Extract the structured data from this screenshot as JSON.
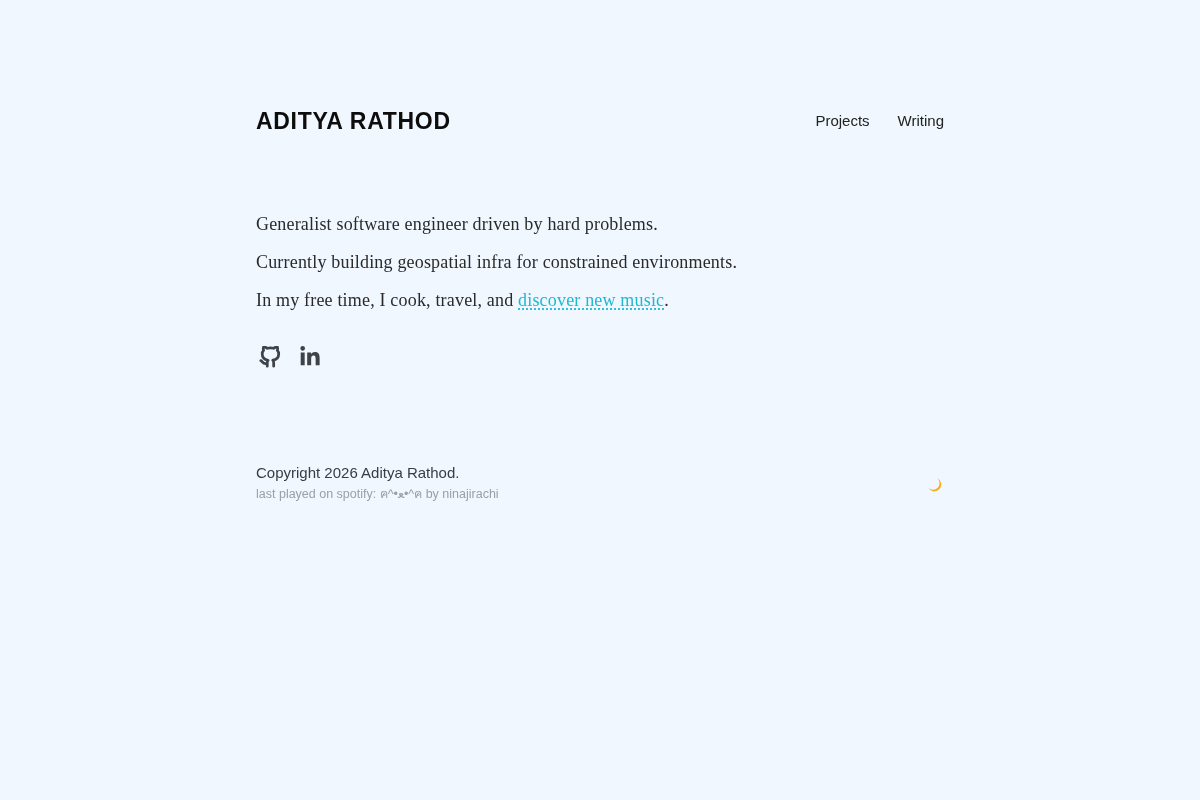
{
  "header": {
    "title": "ADITYA RATHOD",
    "nav": [
      {
        "label": "Projects"
      },
      {
        "label": "Writing"
      }
    ]
  },
  "intro": {
    "paragraphs": [
      {
        "text": "Generalist software engineer driven by hard problems."
      },
      {
        "text": "Currently building geospatial infra for constrained environments."
      },
      {
        "text": "In my free time, I cook, travel, and ",
        "link": "discover new music",
        "after": "."
      }
    ]
  },
  "social_links": [
    {
      "kind": "github"
    },
    {
      "kind": "linkedin"
    }
  ],
  "footer": {
    "copyright": "Copyright 2026 Aditya Rathod.",
    "now_playing": "last played on spotify: ฅ^•ﻌ•^ฅ by ninajirachi"
  }
}
